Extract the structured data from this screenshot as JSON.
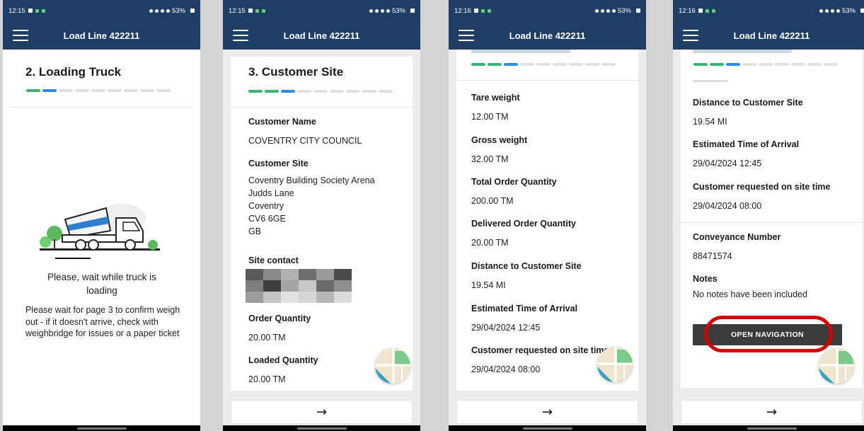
{
  "common": {
    "app_title": "Load Line 422211",
    "battery": "53%",
    "next_arrow": "→"
  },
  "screens": [
    {
      "time": "12:15",
      "title": "2. Loading Truck",
      "progress": [
        "g",
        "b",
        "x",
        "x",
        "x",
        "x",
        "x",
        "x",
        "x"
      ],
      "wait_text": "Please, wait while truck is loading",
      "info_text": "Please wait for page 3 to confirm weigh out - if it doesn't arrive, check with weighbridge for issues or a paper ticket"
    },
    {
      "time": "12:15",
      "title": "3. Customer Site",
      "progress": [
        "g",
        "g",
        "b",
        "x",
        "x",
        "x",
        "x",
        "x",
        "x"
      ],
      "fields": [
        {
          "label": "Customer Name",
          "value": "COVENTRY CITY COUNCIL"
        },
        {
          "label": "Customer Site",
          "lines": [
            "Coventry Building Society Arena",
            "Judds Lane",
            "Coventry",
            "CV6 6GE",
            "GB"
          ]
        },
        {
          "label": "Site contact",
          "value": ""
        },
        {
          "label": "Order Quantity",
          "value": "20.00 TM"
        },
        {
          "label": "Loaded Quantity",
          "value": "20.00 TM"
        }
      ]
    },
    {
      "time": "12:16",
      "progress": [
        "g",
        "g",
        "b",
        "x",
        "x",
        "x",
        "x",
        "x",
        "x"
      ],
      "fields": [
        {
          "label": "Tare weight",
          "value": "12.00 TM"
        },
        {
          "label": "Gross weight",
          "value": "32.00 TM"
        },
        {
          "label": "Total Order Quantity",
          "value": "200.00 TM"
        },
        {
          "label": "Delivered Order Quantity",
          "value": "20.00 TM"
        },
        {
          "label": "Distance to Customer Site",
          "value": "19.54 MI"
        },
        {
          "label": "Estimated Time of Arrival",
          "value": "29/04/2024 12:45"
        },
        {
          "label": "Customer requested on site time",
          "value": "29/04/2024 08:00"
        }
      ]
    },
    {
      "time": "12:16",
      "progress": [
        "g",
        "g",
        "b",
        "x",
        "x",
        "x",
        "x",
        "x",
        "x"
      ],
      "fields": [
        {
          "label": "Distance to Customer Site",
          "value": "19.54 MI"
        },
        {
          "label": "Estimated Time of Arrival",
          "value": "29/04/2024 12:45"
        },
        {
          "label": "Customer requested on site time",
          "value": "29/04/2024 08:00"
        },
        {
          "label": "Conveyance Number",
          "value": "88471574"
        },
        {
          "label": "Notes",
          "value": "No notes have been included"
        }
      ],
      "open_navigation": "OPEN NAVIGATION"
    }
  ],
  "colors": {
    "app_bar": "#1f3e66",
    "progress_done": "#3cb371",
    "progress_current": "#2f8ae5",
    "highlight": "#d40000"
  }
}
